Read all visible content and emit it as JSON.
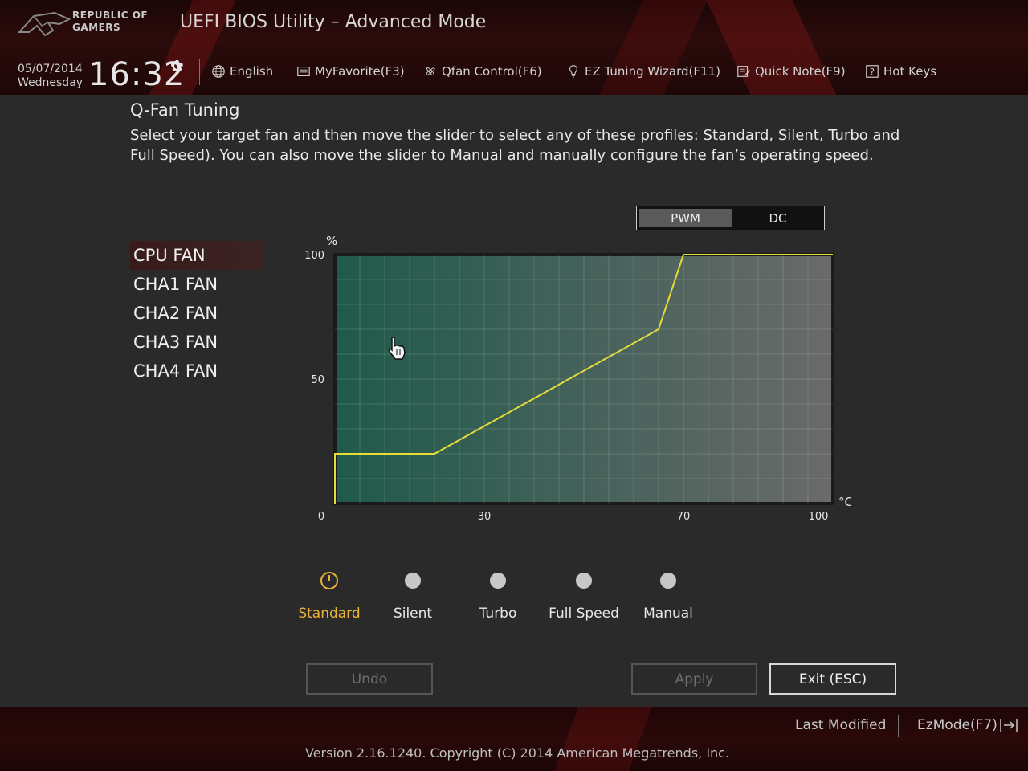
{
  "header": {
    "brand_line1": "REPUBLIC OF",
    "brand_line2": "GAMERS",
    "app_title": "UEFI BIOS Utility – Advanced Mode",
    "date": "05/07/2014",
    "weekday": "Wednesday",
    "time": "16:32",
    "toolbar": {
      "language": "English",
      "favorite": "MyFavorite(F3)",
      "qfan": "Qfan Control(F6)",
      "ez_tuning": "EZ Tuning Wizard(F11)",
      "quick_note": "Quick Note(F9)",
      "hot_keys": "Hot Keys"
    }
  },
  "qfan": {
    "title": "Q-Fan Tuning",
    "description": "Select your target fan and then move the slider to select any of these profiles: Standard, Silent, Turbo and Full Speed). You can also move the slider to Manual and manually configure the fan’s operating speed.",
    "mode_toggle": {
      "pwm": "PWM",
      "dc": "DC",
      "selected": "PWM"
    },
    "fans": [
      "CPU FAN",
      "CHA1 FAN",
      "CHA2 FAN",
      "CHA3 FAN",
      "CHA4 FAN"
    ],
    "selected_fan": "CPU FAN",
    "profiles": [
      "Standard",
      "Silent",
      "Turbo",
      "Full Speed",
      "Manual"
    ],
    "selected_profile": "Standard",
    "buttons": {
      "undo": "Undo",
      "apply": "Apply",
      "exit": "Exit (ESC)"
    }
  },
  "chart_data": {
    "type": "line",
    "xlabel": "°C",
    "ylabel": "%",
    "xlim": [
      0,
      100
    ],
    "ylim": [
      0,
      100
    ],
    "x_ticks": [
      "0",
      "30",
      "70",
      "100"
    ],
    "x_tick_values": [
      0,
      30,
      70,
      100
    ],
    "y_ticks": [
      "100",
      "50"
    ],
    "y_tick_values": [
      100,
      50
    ],
    "grid": true,
    "colors": {
      "line": "#e6dc3a",
      "fill_start": "#1f5a4a",
      "fill_end": "#6a6a6a"
    },
    "series": [
      {
        "x": [
          0,
          0,
          20,
          65,
          70,
          100
        ],
        "y": [
          0,
          20,
          20,
          70,
          100,
          100
        ]
      }
    ]
  },
  "footer": {
    "last_modified": "Last Modified",
    "ezmode": "EzMode(F7)",
    "version": "Version 2.16.1240. Copyright (C) 2014 American Megatrends, Inc."
  }
}
